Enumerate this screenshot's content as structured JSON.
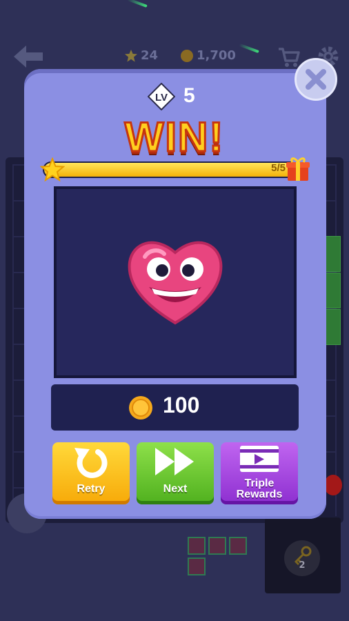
{
  "hud": {
    "stars": "24",
    "coins": "1,700",
    "key_count": "2"
  },
  "dialog": {
    "level_badge": "LV",
    "level_number": "5",
    "title": "WIN!",
    "progress_text": "5/5",
    "progress_fraction": 1.0,
    "reward_amount": "100"
  },
  "buttons": {
    "retry_label": "Retry",
    "next_label": "Next",
    "triple_line1": "Triple",
    "triple_line2": "Rewards"
  },
  "icons": {
    "back": "back-arrow-icon",
    "star": "star-icon",
    "coin": "coin-icon",
    "cart": "shopping-cart-icon",
    "settings": "gear-icon",
    "close": "close-icon",
    "gift": "gift-icon",
    "reward": "heart-character-icon",
    "retry": "retry-arrow-icon",
    "next": "fast-forward-icon",
    "triple": "video-play-icon",
    "key": "key-icon"
  },
  "colors": {
    "dialog_bg": "#8b8fe3",
    "retry_button": "#f7a908",
    "next_button": "#4fb01e",
    "triple_button": "#8d2fd0",
    "title": "#ffcf1f"
  }
}
